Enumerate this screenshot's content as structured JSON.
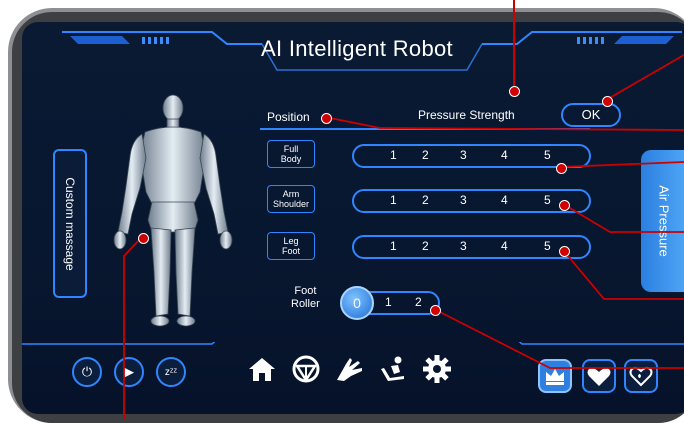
{
  "title": "AI Intelligent Robot",
  "headers": {
    "position": "Position",
    "pressure": "Pressure Strength"
  },
  "ok_label": "OK",
  "side_tabs": {
    "left": "Custom massage",
    "right": "Air Pressure"
  },
  "parts": [
    {
      "line1": "Full",
      "line2": "Body"
    },
    {
      "line1": "Arm",
      "line2": "Shoulder"
    },
    {
      "line1": "Leg",
      "line2": "Foot"
    }
  ],
  "levels": [
    "1",
    "2",
    "3",
    "4",
    "5"
  ],
  "foot_roller": {
    "line1": "Foot",
    "line2": "Roller",
    "selected": "0",
    "options": [
      "1",
      "2"
    ]
  },
  "bottom_icons": {
    "left": [
      "power-icon",
      "play-icon",
      "sleep-icon"
    ],
    "nav": [
      "home-icon",
      "mask-icon",
      "hand-icon",
      "recline-icon",
      "gear-icon"
    ],
    "right": [
      "crown-icon",
      "heart-icon",
      "heart-shield-icon"
    ]
  },
  "colors": {
    "accent": "#2f86ff",
    "background": "#081730",
    "callout": "#cc0000"
  }
}
